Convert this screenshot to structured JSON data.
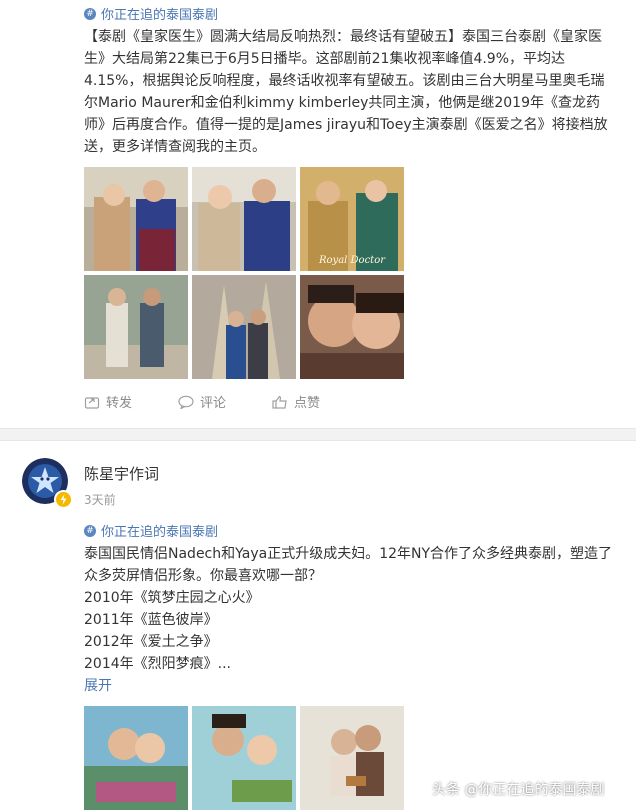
{
  "post1": {
    "topic": "你正在追的泰国泰剧",
    "paragraphs": [
      "【泰剧《皇家医生》圆满大结局反响热烈：最终话有望破五】泰国三台泰剧《皇家医生》大结局第22集已于6月5日播毕。这部剧前21集收视率峰值4.9%，平均达4.15%，根据舆论反响程度，最终话收视率有望破五。该剧由三台大明星马里奥毛瑞尔Mario Maurer和金伯利kimmy kimberley共同主演，他俩是继2019年《查龙药师》后再度合作。值得一提的是James jirayu和Toey主演泰剧《医爱之名》将接档放送，更多详情查阅我的主页。"
    ],
    "image_caption": "Royal Doctor",
    "actions": {
      "repost": "转发",
      "comment": "评论",
      "like": "点赞"
    }
  },
  "post2": {
    "username": "陈星宇作词",
    "time": "3天前",
    "topic": "你正在追的泰国泰剧",
    "lines": [
      "泰国国民情侣Nadech和Yaya正式升级成夫妇。12年NY合作了众多经典泰剧，塑造了众多荧屏情侣形象。你最喜欢哪一部？",
      "2010年《筑梦庄园之心火》",
      "2011年《蓝色彼岸》",
      "2012年《爱土之争》",
      "2014年《烈阳梦痕》..."
    ],
    "expand": "展开"
  },
  "watermark": "头条 @你正在追的泰国泰剧",
  "colors": {
    "link": "#4a76b3",
    "muted": "#8a8a8a",
    "divider": "#f2f2f2"
  }
}
